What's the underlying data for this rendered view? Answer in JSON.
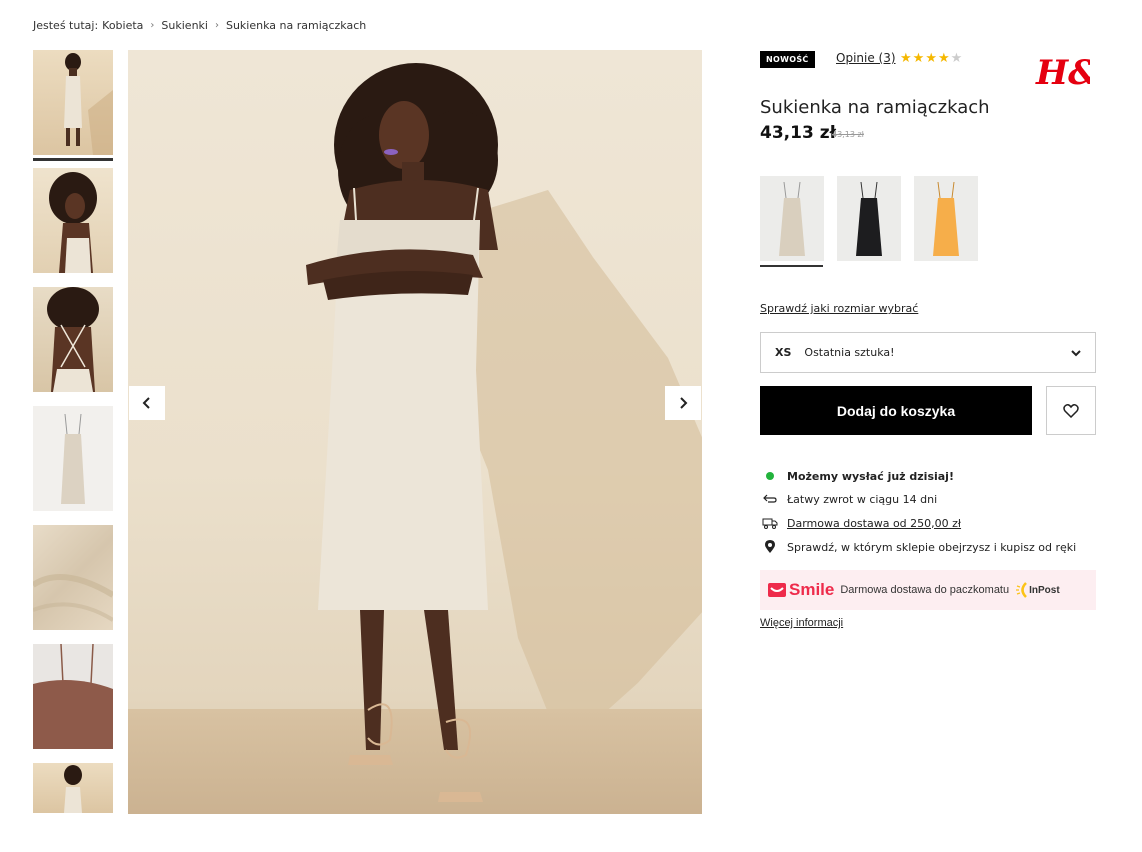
{
  "breadcrumb": {
    "prefix": "Jesteś tutaj:",
    "items": [
      "Kobieta",
      "Sukienki",
      "Sukienka na ramiączkach"
    ],
    "separator": "›"
  },
  "gallery": {
    "thumbnails": [
      {
        "name": "model-front"
      },
      {
        "name": "model-side"
      },
      {
        "name": "model-back"
      },
      {
        "name": "dress-flat"
      },
      {
        "name": "fabric-detail"
      },
      {
        "name": "strap-detail"
      },
      {
        "name": "model-front-small"
      }
    ],
    "active_index": 0,
    "prev_icon": "chevron-left-icon",
    "next_icon": "chevron-right-icon"
  },
  "product": {
    "badge": "NOWOŚĆ",
    "reviews_label": "Opinie (3)",
    "rating": 4,
    "rating_max": 5,
    "brand": "H&M",
    "title": "Sukienka na ramiączkach",
    "price": "43,13 zł",
    "old_price": "43,13 zł",
    "colors": [
      {
        "name": "beige",
        "hex": "#e2d8c8"
      },
      {
        "name": "black",
        "hex": "#1d1d1f"
      },
      {
        "name": "orange",
        "hex": "#f6ae4a"
      }
    ],
    "selected_color_index": 0
  },
  "size": {
    "guide_link": "Sprawdź jaki rozmiar wybrać",
    "selected_size": "XS",
    "status": "Ostatnia sztuka!"
  },
  "actions": {
    "add_to_cart": "Dodaj do koszyka",
    "wishlist_icon": "heart-icon"
  },
  "info": {
    "ship_today": "Możemy wysłać już dzisiaj!",
    "returns": "Łatwy zwrot w ciągu 14 dni",
    "free_delivery": "Darmowa dostawa od 250,00 zł",
    "store_check": "Sprawdź, w którym sklepie obejrzysz i  kupisz od ręki"
  },
  "smile": {
    "brand": "Smile",
    "text": "Darmowa dostawa do paczkomatu",
    "partner": "InPost",
    "more_info": "Więcej informacji"
  },
  "colors": {
    "accent_green": "#22b33c",
    "smile_red": "#ee2b4b",
    "smile_bg": "#fdeef1",
    "star": "#f5b800",
    "hm_red": "#e50010"
  }
}
